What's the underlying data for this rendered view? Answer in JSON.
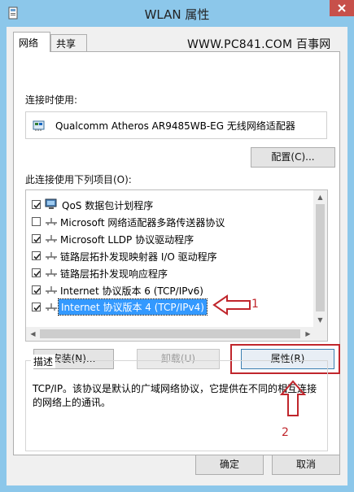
{
  "window": {
    "title": "WLAN 属性"
  },
  "tabs": [
    {
      "label": "网络"
    },
    {
      "label": "共享"
    }
  ],
  "watermark": "WWW.PC841.COM 百事网",
  "connect_using": {
    "label": "连接时使用:",
    "adapter": "Qualcomm Atheros AR9485WB-EG 无线网络适配器",
    "configure_button": "配置(C)..."
  },
  "items_section": {
    "label": "此连接使用下列项目(O):",
    "items": [
      {
        "label": "QoS 数据包计划程序",
        "checked": true,
        "icon": "qos-icon"
      },
      {
        "label": "Microsoft 网络适配器多路传送器协议",
        "checked": false,
        "icon": "protocol-icon"
      },
      {
        "label": "Microsoft LLDP 协议驱动程序",
        "checked": true,
        "icon": "protocol-icon"
      },
      {
        "label": "链路层拓扑发现映射器 I/O 驱动程序",
        "checked": true,
        "icon": "protocol-icon"
      },
      {
        "label": "链路层拓扑发现响应程序",
        "checked": true,
        "icon": "protocol-icon"
      },
      {
        "label": "Internet 协议版本 6 (TCP/IPv6)",
        "checked": true,
        "icon": "protocol-icon"
      },
      {
        "label": "Internet 协议版本 4 (TCP/IPv4)",
        "checked": true,
        "icon": "protocol-icon",
        "selected": true
      }
    ]
  },
  "buttons": {
    "install": "安装(N)...",
    "uninstall": "卸载(U)",
    "properties": "属性(R)",
    "ok": "确定",
    "cancel": "取消"
  },
  "description": {
    "title": "描述",
    "text": "TCP/IP。该协议是默认的广域网络协议，它提供在不同的相互连接的网络上的通讯。"
  },
  "annotations": {
    "one": "1",
    "two": "2"
  },
  "colors": {
    "titlebar": "#8cc7ea",
    "close": "#c7504a",
    "selection": "#3399ff",
    "annotation": "#c0262c"
  }
}
